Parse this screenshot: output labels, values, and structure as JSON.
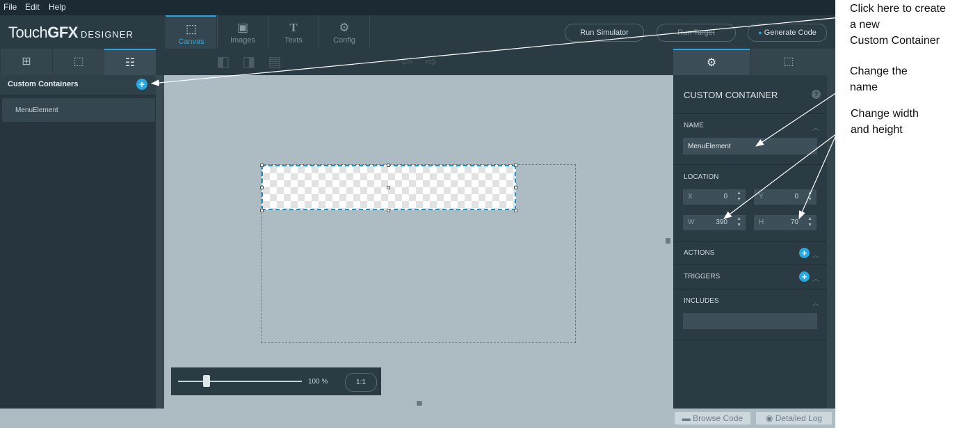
{
  "menu": {
    "file": "File",
    "edit": "Edit",
    "help": "Help"
  },
  "logo": {
    "touch": "Touch",
    "gfx": "GFX",
    "designer": "DESIGNER"
  },
  "top_tabs": [
    {
      "label": "Canvas",
      "icon": "canvas-icon"
    },
    {
      "label": "Images",
      "icon": "images-icon"
    },
    {
      "label": "Texts",
      "icon": "texts-icon"
    },
    {
      "label": "Config",
      "icon": "config-icon"
    }
  ],
  "actions": {
    "run_simulator": "Run Simulator",
    "run_target": "Run Target",
    "generate_code": "Generate Code"
  },
  "left_panel": {
    "title": "Custom Containers",
    "items": [
      "MenuElement"
    ]
  },
  "canvas": {
    "zoom": "100 %",
    "zoom_reset": "1:1",
    "zoom_fraction": 0.23
  },
  "properties": {
    "title": "CUSTOM CONTAINER",
    "help": "?",
    "name_section": "NAME",
    "name_value": "MenuElement",
    "location_section": "LOCATION",
    "x_label": "X",
    "x_value": "0",
    "y_label": "Y",
    "y_value": "0",
    "w_label": "W",
    "w_value": "390",
    "h_label": "H",
    "h_value": "70",
    "actions_section": "ACTIONS",
    "triggers_section": "TRIGGERS",
    "includes_section": "INCLUDES"
  },
  "bottom": {
    "browse_code": "Browse Code",
    "detailed_log": "Detailed Log"
  },
  "annotations": {
    "a1_l1": "Click here to create",
    "a1_l2": "a new",
    "a1_l3": "Custom Container",
    "a2_l1": "Change the",
    "a2_l2": "name",
    "a3_l1": "Change width",
    "a3_l2": "and height"
  },
  "colors": {
    "accent": "#26a9e0",
    "panel": "#2b3b44",
    "canvas": "#adbcc2"
  }
}
